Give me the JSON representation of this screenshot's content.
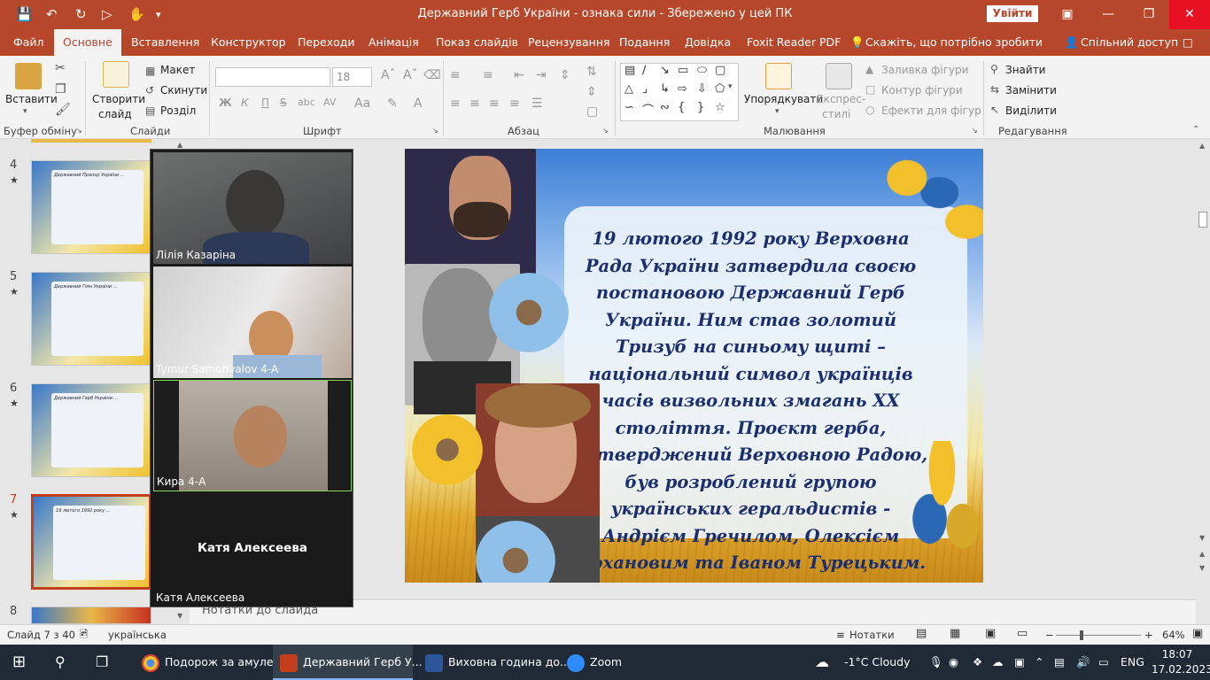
{
  "window": {
    "title": "Державний Герб України - ознака сили  -  Збережено у цей ПК",
    "signin": "Увійти"
  },
  "tabs": [
    "Файл",
    "Основне",
    "Вставлення",
    "Конструктор",
    "Переходи",
    "Анімація",
    "Показ слайдів",
    "Рецензування",
    "Подання",
    "Довідка",
    "Foxit Reader PDF",
    "Скажіть, що потрібно зробити",
    "Спільний доступ"
  ],
  "ribbon": {
    "clipboard": {
      "paste": "Вставити",
      "label": "Буфер обміну"
    },
    "slides": {
      "new": "Створити",
      "new2": "слайд",
      "layout": "Макет",
      "reset": "Скинути",
      "section": "Розділ",
      "label": "Слайди"
    },
    "font": {
      "size": "18",
      "bold": "Ж",
      "italic": "К",
      "underline": "П",
      "strike": "S",
      "label": "Шрифт"
    },
    "paragraph": {
      "label": "Абзац"
    },
    "drawing": {
      "arrange": "Упорядкувати",
      "quick1": "Експрес-",
      "quick2": "стилі",
      "fill": "Заливка фігури",
      "outline": "Контур фігури",
      "effects": "Ефекти для фігур",
      "label": "Малювання"
    },
    "editing": {
      "find": "Знайти",
      "replace": "Замінити",
      "select": "Виділити",
      "label": "Редагування"
    }
  },
  "slides_panel": {
    "items": [
      {
        "num": "4",
        "star": "★",
        "text": "Державний Прапор України ..."
      },
      {
        "num": "5",
        "star": "★",
        "text": "Державний Гімн України ..."
      },
      {
        "num": "6",
        "star": "★",
        "text": "Державний Герб України ..."
      },
      {
        "num": "7",
        "star": "★",
        "text": "19 лютого 1992 року ..."
      },
      {
        "num": "8",
        "star": "",
        "text": ""
      }
    ]
  },
  "slide": {
    "text": "19 лютого 1992 року Верховна Рада України затвердила своєю постановою Державний Герб України. Ним став золотий Тризуб на синьому щиті  – національний символ українців часів визвольних змагань ХХ століття. Проєкт герба, затверджений Верховною Радою, був розроблений групою українських геральдистів  - Андрієм Гречилом, Олексієм Кохановим та Іваном Турецьким."
  },
  "notes": {
    "placeholder": "Нотатки до слайда"
  },
  "zoom": {
    "participants": [
      {
        "name": "Лілія Казаріна"
      },
      {
        "name": "Tymur Samohvalov 4-A"
      },
      {
        "name": "Кира 4-А"
      },
      {
        "name": "Катя Алексеева",
        "center": "Катя Алексеева"
      }
    ]
  },
  "status": {
    "slide": "Слайд 7 з 40",
    "lang": "українська",
    "notes": "Нотатки",
    "zoom": "64%",
    "zoom_level": 64
  },
  "taskbar": {
    "apps": [
      {
        "label": "Подорож за амуле..."
      },
      {
        "label": "Державний Герб У..."
      },
      {
        "label": "Виховна година до..."
      },
      {
        "label": "Zoom"
      }
    ],
    "weather": "-1°C  Cloudy",
    "lang": "ENG",
    "time": "18:07",
    "date": "17.02.2023"
  }
}
